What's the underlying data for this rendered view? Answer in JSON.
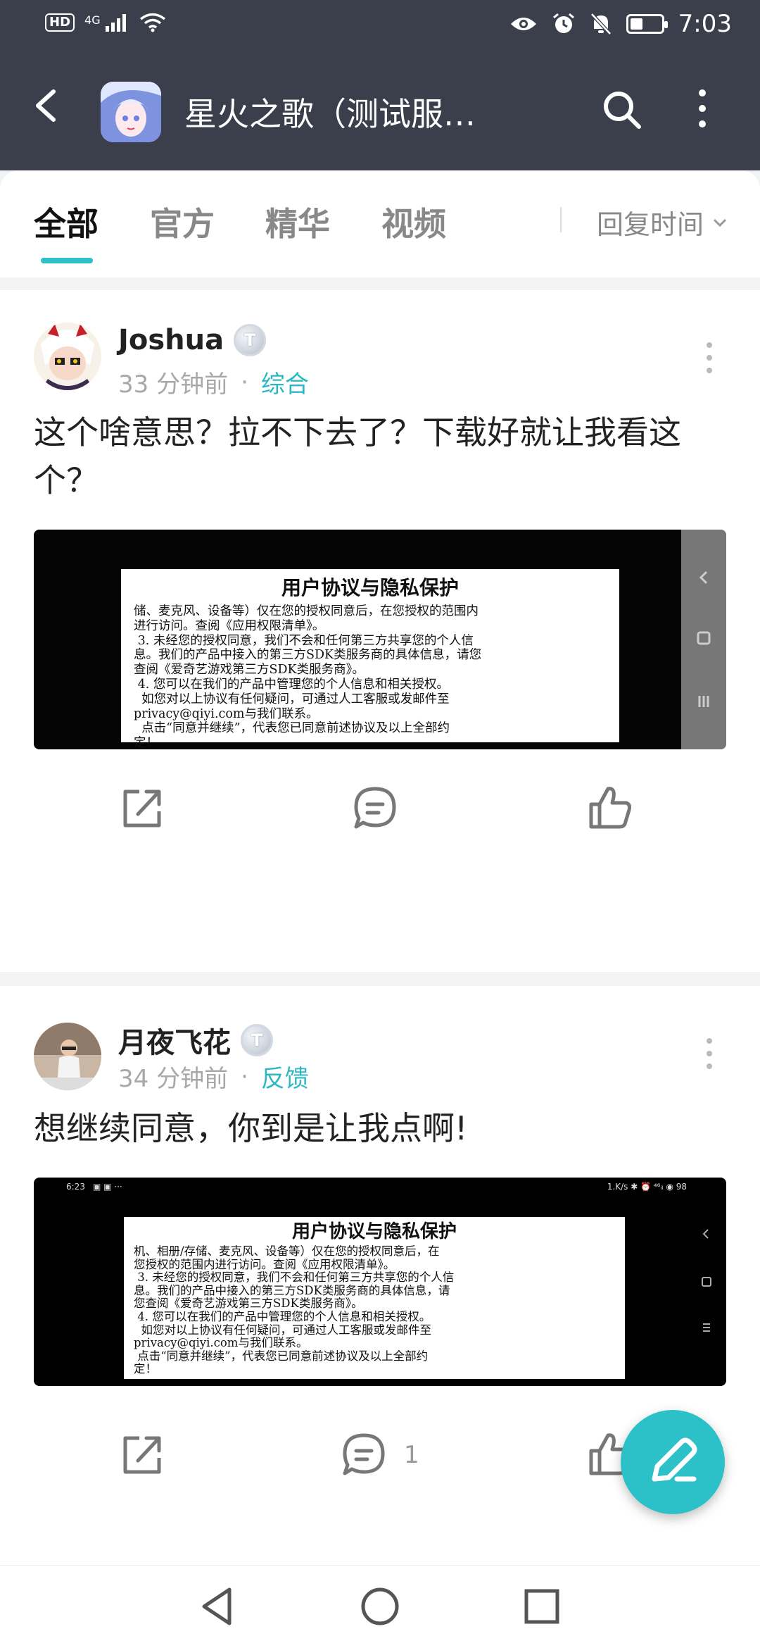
{
  "status_bar": {
    "left_badge": "HD",
    "network": "4G",
    "time": "7:03",
    "battery_level": 0.4
  },
  "app_bar": {
    "title": "星火之歌（测试服…",
    "back_icon": "back-arrow-icon",
    "search_icon": "search-icon",
    "more_icon": "more-vertical-icon"
  },
  "tabs": {
    "items": [
      "全部",
      "官方",
      "精华",
      "视频"
    ],
    "active_index": 0,
    "sort_label": "回复时间"
  },
  "posts": [
    {
      "author": "Joshua",
      "level_badge": "T",
      "time": "33 分钟前",
      "separator": "·",
      "category": "综合",
      "text": "这个啥意思？拉不下去了？下载好就让我看这个？",
      "image": {
        "doc_title": "用户协议与隐私保护",
        "doc_lines": [
          "储、麦克风、设备等）仅在您的授权同意后，在您授权的范围内",
          "进行访问。查阅《应用权限清单》。",
          " 3. 未经您的授权同意，我们不会和任何第三方共享您的个人信",
          "息。我们的产品中接入的第三方SDK类服务商的具体信息，请您",
          "查阅《爱奇艺游戏第三方SDK类服务商》。",
          " 4. 您可以在我们的产品中管理您的个人信息和相关授权。",
          "  如您对以上协议有任何疑问，可通过人工客服或发邮件至",
          "privacy@qiyi.com与我们联系。",
          "  点击“同意并继续”，代表您已同意前述协议及以上全部约",
          "定！"
        ],
        "side_nav_icons": [
          "back-triangle-icon",
          "home-square-icon",
          "recents-lines-icon"
        ]
      },
      "actions": {
        "share_icon": "share-icon",
        "comment_icon": "comment-icon",
        "comment_count": "",
        "like_icon": "thumbs-up-icon"
      }
    },
    {
      "author": "月夜飞花",
      "level_badge": "T",
      "time": "34 分钟前",
      "separator": "·",
      "category": "反馈",
      "text": "想继续同意，你到是让我点啊!",
      "image": {
        "status_time": "6:23",
        "status_icons_left": "▣ ▣ ···",
        "status_right": "1.K/s ✱ ⏰ ⁴⁶ᵢₗ ◉ 98",
        "doc_title": "用户协议与隐私保护",
        "doc_lines": [
          "机、相册/存储、麦克风、设备等）仅在您的授权同意后，在",
          "您授权的范围内进行访问。查阅《应用权限清单》。",
          " 3. 未经您的授权同意，我们不会和任何第三方共享您的个人信",
          "息。我们的产品中接入的第三方SDK类服务商的具体信息，请",
          "您查阅《爱奇艺游戏第三方SDK类服务商》。",
          " 4. 您可以在我们的产品中管理您的个人信息和相关授权。",
          "  如您对以上协议有任何疑问，可通过人工客服或发邮件至",
          "privacy@qiyi.com与我们联系。",
          " 点击“同意并继续”，代表您已同意前述协议及以上全部约",
          "定！"
        ]
      },
      "actions": {
        "share_icon": "share-icon",
        "comment_icon": "comment-icon",
        "comment_count": "1",
        "like_icon": "thumbs-up-icon"
      }
    }
  ],
  "fab": {
    "icon": "compose-pen-icon"
  },
  "nav_bar": {
    "icons": [
      "nav-back-icon",
      "nav-home-icon",
      "nav-recents-icon"
    ]
  },
  "colors": {
    "header_bg": "#3a3f4b",
    "accent": "#2cc0c8",
    "category_text": "#2cb8c2"
  }
}
